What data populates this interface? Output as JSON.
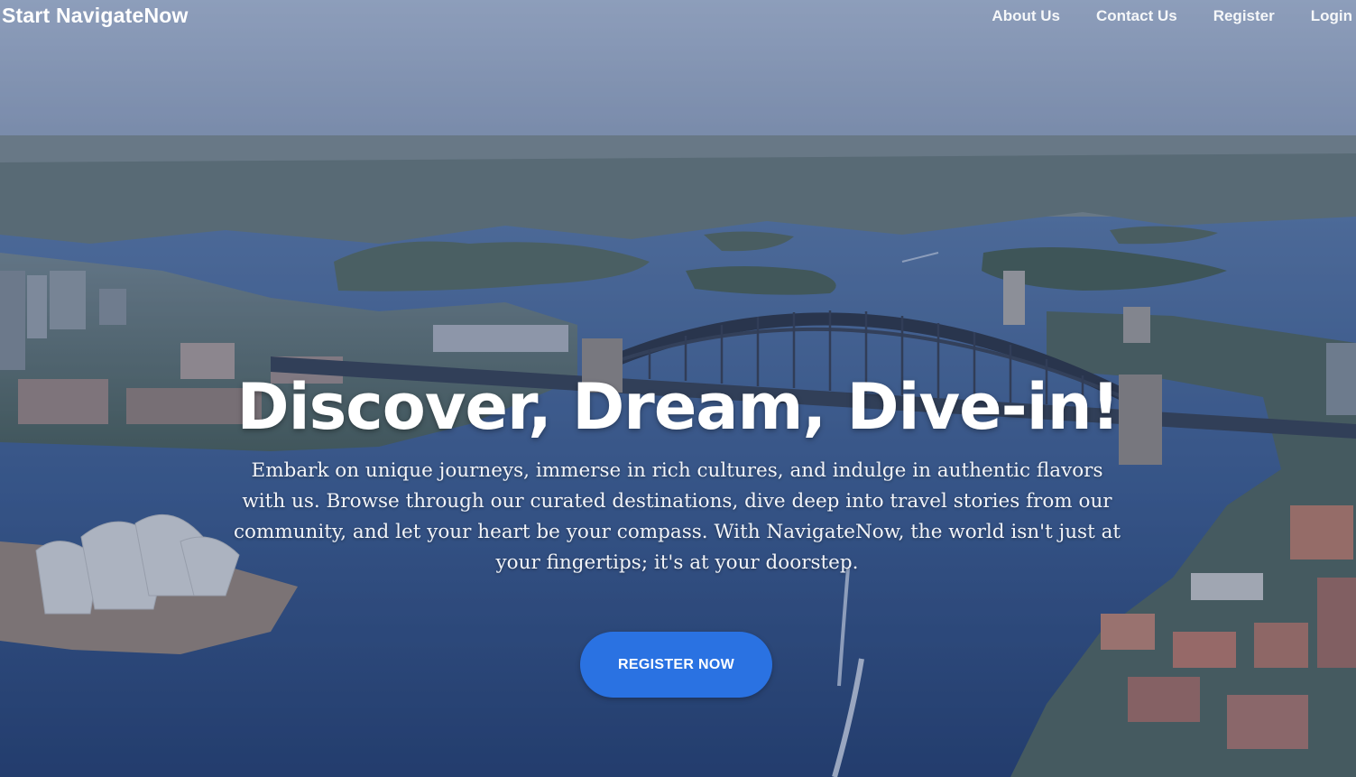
{
  "brand": {
    "title": "Start NavigateNow"
  },
  "nav": {
    "items": [
      {
        "label": "About Us"
      },
      {
        "label": "Contact Us"
      },
      {
        "label": "Register"
      },
      {
        "label": "Login"
      }
    ]
  },
  "hero": {
    "headline": "Discover, Dream, Dive-in!",
    "description": "Embark on unique journeys, immerse in rich cultures, and indulge in authentic flavors with us. Browse through our curated destinations, dive deep into travel stories from our community, and let your heart be your compass. With NavigateNow, the world isn't just at your fingertips; it's at your doorstep.",
    "cta_label": "REGISTER NOW",
    "background_image": "aerial-harbour-bridge-photo"
  },
  "colors": {
    "accent": "#2a72e2",
    "overlay": "#1e376e"
  }
}
